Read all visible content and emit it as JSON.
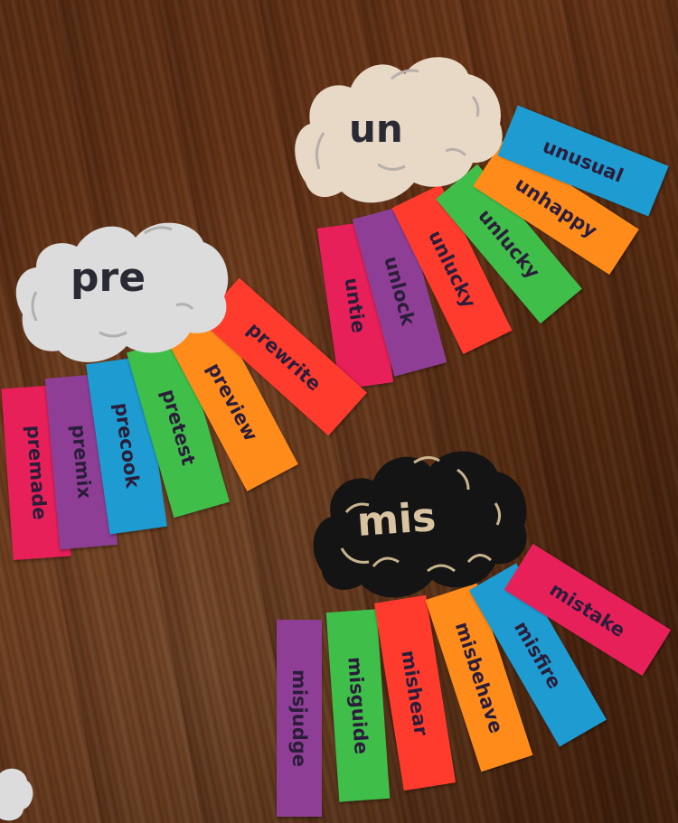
{
  "clouds": {
    "un": {
      "label": "un",
      "fill": "#e8d8c6",
      "text_color": "#2a2a35"
    },
    "pre": {
      "label": "pre",
      "fill": "#dcdcdc",
      "text_color": "#2a2a35"
    },
    "mis": {
      "label": "mis",
      "fill": "#141414",
      "text_color": "#d8c4a0"
    }
  },
  "strips": {
    "un": [
      {
        "word": "untie",
        "color": "#e8205a"
      },
      {
        "word": "unlock",
        "color": "#8e3f95"
      },
      {
        "word": "unlucky",
        "color": "#ff3b2e"
      },
      {
        "word": "unlucky",
        "color": "#3fbf4a"
      },
      {
        "word": "unhappy",
        "color": "#ff8c1a"
      },
      {
        "word": "unusual",
        "color": "#1e9bd0"
      }
    ],
    "pre": [
      {
        "word": "premade",
        "color": "#e8205a"
      },
      {
        "word": "premix",
        "color": "#8e3f95"
      },
      {
        "word": "precook",
        "color": "#1e9bd0"
      },
      {
        "word": "pretest",
        "color": "#3fbf4a"
      },
      {
        "word": "preview",
        "color": "#ff8c1a"
      },
      {
        "word": "prewrite",
        "color": "#ff3b2e"
      }
    ],
    "mis": [
      {
        "word": "misjudge",
        "color": "#8e3f95"
      },
      {
        "word": "misguide",
        "color": "#3fbf4a"
      },
      {
        "word": "mishear",
        "color": "#ff3b2e"
      },
      {
        "word": "misbehave",
        "color": "#ff8c1a"
      },
      {
        "word": "misfire",
        "color": "#1e9bd0"
      },
      {
        "word": "mistake",
        "color": "#e8205a"
      }
    ]
  }
}
